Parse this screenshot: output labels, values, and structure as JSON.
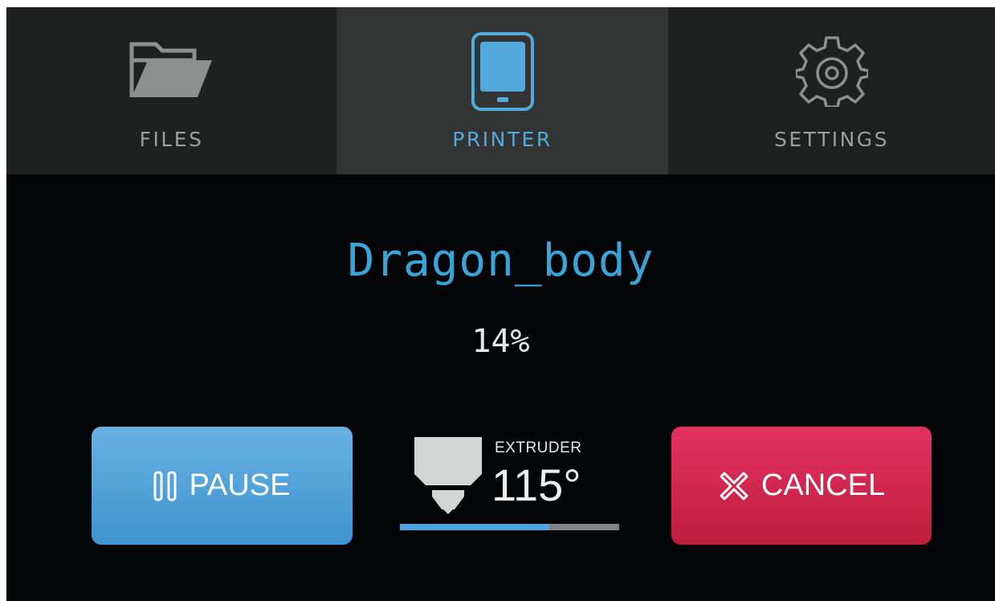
{
  "tabs": {
    "files": {
      "label": "FILES",
      "icon": "folder-icon"
    },
    "printer": {
      "label": "PRINTER",
      "icon": "printer-screen-icon",
      "active": true
    },
    "settings": {
      "label": "SETTINGS",
      "icon": "gear-icon"
    }
  },
  "job": {
    "name": "Dragon_body",
    "progress_text": "14%"
  },
  "controls": {
    "pause_label": "PAUSE",
    "cancel_label": "CANCEL"
  },
  "extruder": {
    "label": "EXTRUDER",
    "temperature": "115°",
    "bar_fill_fraction": 0.68
  },
  "colors": {
    "accent_blue": "#3aa4d8",
    "pause_button": "#4a9cd6",
    "cancel_button": "#d42a52",
    "background": "#030405",
    "tab_bg": "#1f2020",
    "tab_active_bg": "#323333"
  }
}
